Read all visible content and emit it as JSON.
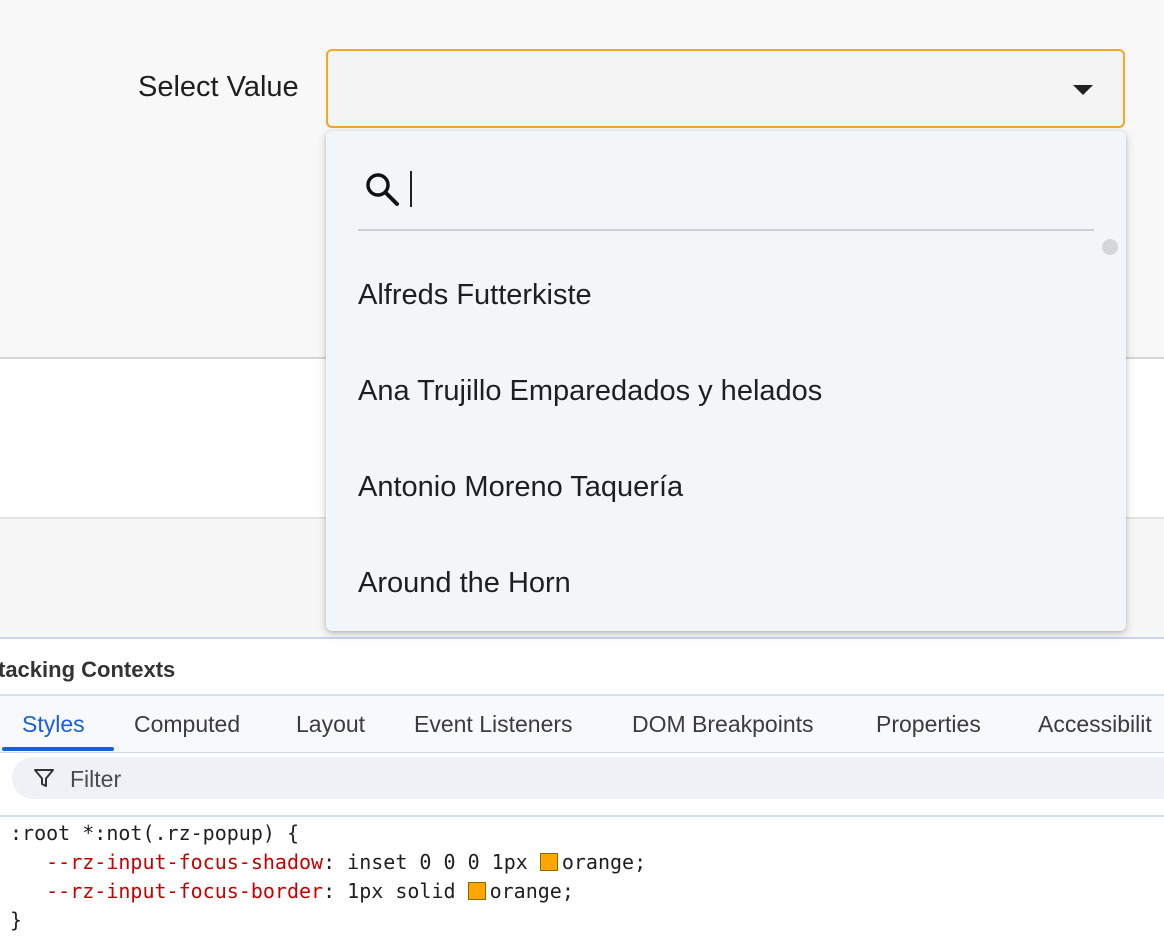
{
  "form": {
    "label": "Select Value",
    "selected_value": ""
  },
  "popup": {
    "search": {
      "value": "",
      "placeholder": ""
    },
    "options": [
      "Alfreds Futterkiste",
      "Ana Trujillo Emparedados y helados",
      "Antonio Moreno Taquería",
      "Around the Horn"
    ]
  },
  "devtools": {
    "section_title": "tacking Contexts",
    "tabs": [
      "Styles",
      "Computed",
      "Layout",
      "Event Listeners",
      "DOM Breakpoints",
      "Properties",
      "Accessibilit"
    ],
    "active_tab": "Styles",
    "filter_placeholder": "Filter",
    "css_rule": {
      "selector": ":root *:not(.rz-popup) {",
      "declarations": [
        {
          "property": "--rz-input-focus-shadow",
          "value_prefix": "inset 0 0 0 1px",
          "color_name": "orange",
          "swatch_color": "#ffa500"
        },
        {
          "property": "--rz-input-focus-border",
          "value_prefix": "1px solid",
          "color_name": "orange",
          "swatch_color": "#ffa500"
        }
      ],
      "close": "}"
    }
  },
  "colors": {
    "focus_border": "#f5a623",
    "active_tab": "#1a5ed8",
    "css_property": "#c80000"
  }
}
